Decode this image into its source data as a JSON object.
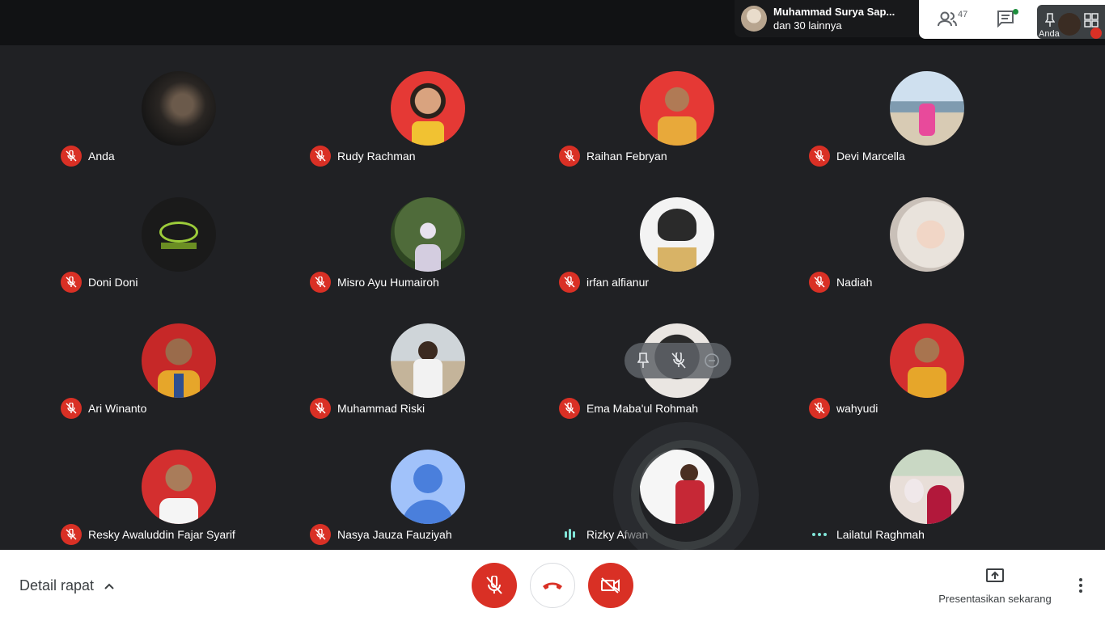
{
  "presenter": {
    "name": "Muhammad Surya Sap...",
    "others": "dan 30 lainnya"
  },
  "top_actions": {
    "participant_count": "47",
    "self_label": "Anda"
  },
  "participants": [
    {
      "name": "Anda",
      "status": "muted"
    },
    {
      "name": "Rudy Rachman",
      "status": "muted"
    },
    {
      "name": "Raihan Febryan",
      "status": "muted"
    },
    {
      "name": "Devi Marcella",
      "status": "muted"
    },
    {
      "name": "Doni Doni",
      "status": "muted"
    },
    {
      "name": "Misro Ayu Humairoh",
      "status": "muted"
    },
    {
      "name": "irfan alfianur",
      "status": "muted"
    },
    {
      "name": "Nadiah",
      "status": "muted"
    },
    {
      "name": "Ari Winanto",
      "status": "muted"
    },
    {
      "name": "Muhammad Riski",
      "status": "muted"
    },
    {
      "name": "Ema Maba'ul Rohmah",
      "status": "muted"
    },
    {
      "name": "wahyudi",
      "status": "muted"
    },
    {
      "name": "Resky Awaluddin Fajar Syarif",
      "status": "muted"
    },
    {
      "name": "Nasya Jauza Fauziyah",
      "status": "muted"
    },
    {
      "name": "Rizky Afwan",
      "status": "speaking"
    },
    {
      "name": "Lailatul Raghmah",
      "status": "connecting"
    }
  ],
  "bottom": {
    "details_label": "Detail rapat",
    "present_label": "Presentasikan sekarang"
  },
  "colors": {
    "danger": "#d93025",
    "stage": "#202124",
    "speaking": "#81e6d9"
  }
}
